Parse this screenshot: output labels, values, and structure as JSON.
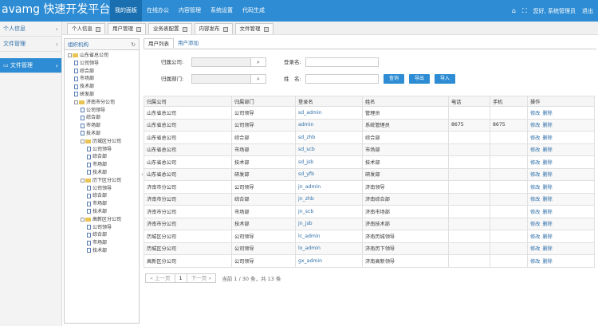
{
  "app": {
    "title": "avamg 快速开发平台"
  },
  "topnav": [
    {
      "label": "我的面板",
      "active": true
    },
    {
      "label": "在线办公",
      "active": false
    },
    {
      "label": "内容管理",
      "active": false
    },
    {
      "label": "系统设置",
      "active": false
    },
    {
      "label": "代码生成",
      "active": false
    }
  ],
  "topright": {
    "user": "您好, 系统管理员",
    "logout": "退出"
  },
  "sidebar": {
    "items": [
      {
        "label": "个人信息",
        "caret": "›"
      },
      {
        "label": "文件管理",
        "caret": "›"
      },
      {
        "label": "文件管理",
        "caret": "‹"
      }
    ]
  },
  "pagetabs": [
    "个人信息",
    "用户管理",
    "业务表配置",
    "内容发布",
    "文件管理"
  ],
  "tree": {
    "header": "组织机构",
    "nodes": [
      {
        "label": "山东省总公司",
        "level": 1,
        "type": "folder",
        "pm": true
      },
      {
        "label": "公司领导",
        "level": 2,
        "type": "page"
      },
      {
        "label": "综合部",
        "level": 2,
        "type": "page"
      },
      {
        "label": "市场部",
        "level": 2,
        "type": "page"
      },
      {
        "label": "技术部",
        "level": 2,
        "type": "page"
      },
      {
        "label": "研发部",
        "level": 2,
        "type": "page"
      },
      {
        "label": "济南市分公司",
        "level": 2,
        "type": "folder",
        "pm": true
      },
      {
        "label": "公司领导",
        "level": 3,
        "type": "page"
      },
      {
        "label": "综合部",
        "level": 3,
        "type": "page"
      },
      {
        "label": "市场部",
        "level": 3,
        "type": "page"
      },
      {
        "label": "技术部",
        "level": 3,
        "type": "page"
      },
      {
        "label": "历城区分公司",
        "level": 3,
        "type": "folder",
        "pm": true
      },
      {
        "label": "公司领导",
        "level": 4,
        "type": "page"
      },
      {
        "label": "综合部",
        "level": 4,
        "type": "page"
      },
      {
        "label": "市场部",
        "level": 4,
        "type": "page"
      },
      {
        "label": "技术部",
        "level": 4,
        "type": "page"
      },
      {
        "label": "历下区分公司",
        "level": 3,
        "type": "folder",
        "pm": true
      },
      {
        "label": "公司领导",
        "level": 4,
        "type": "page"
      },
      {
        "label": "综合部",
        "level": 4,
        "type": "page"
      },
      {
        "label": "市场部",
        "level": 4,
        "type": "page"
      },
      {
        "label": "技术部",
        "level": 4,
        "type": "page"
      },
      {
        "label": "高新区分公司",
        "level": 3,
        "type": "folder",
        "pm": true
      },
      {
        "label": "公司领导",
        "level": 4,
        "type": "page"
      },
      {
        "label": "综合部",
        "level": 4,
        "type": "page"
      },
      {
        "label": "市场部",
        "level": 4,
        "type": "page"
      },
      {
        "label": "技术部",
        "level": 4,
        "type": "page"
      }
    ]
  },
  "subtabs": [
    {
      "label": "用户列表",
      "active": true
    },
    {
      "label": "用户添加",
      "active": false
    }
  ],
  "form": {
    "company_label": "归属公司:",
    "dept_label": "归属部门:",
    "login_label": "登录名:",
    "name_label": "姓　名:",
    "company_value": "",
    "dept_value": "",
    "login_value": "",
    "name_value": "",
    "search_icon": "search-icon",
    "query": "查询",
    "export": "导出",
    "import": "导入"
  },
  "table": {
    "headers": [
      "归属公司",
      "归属部门",
      "登录名",
      "姓名",
      "电话",
      "手机",
      "操作"
    ],
    "rows": [
      [
        "山东省总公司",
        "公司领导",
        "sd_admin",
        "管理员",
        "",
        "",
        "修改",
        "删除"
      ],
      [
        "山东省总公司",
        "公司领导",
        "admin",
        "系统管理员",
        "8675",
        "8675",
        "修改",
        "删除"
      ],
      [
        "山东省总公司",
        "综合部",
        "sd_zhb",
        "综合部",
        "",
        "",
        "修改",
        "删除"
      ],
      [
        "山东省总公司",
        "市场部",
        "sd_scb",
        "市场部",
        "",
        "",
        "修改",
        "删除"
      ],
      [
        "山东省总公司",
        "技术部",
        "sd_jsb",
        "技术部",
        "",
        "",
        "修改",
        "删除"
      ],
      [
        "山东省总公司",
        "研发部",
        "sd_yfb",
        "研发部",
        "",
        "",
        "修改",
        "删除"
      ],
      [
        "济南市分公司",
        "公司领导",
        "jn_admin",
        "济南领导",
        "",
        "",
        "修改",
        "删除"
      ],
      [
        "济南市分公司",
        "综合部",
        "jn_zhb",
        "济南综合部",
        "",
        "",
        "修改",
        "删除"
      ],
      [
        "济南市分公司",
        "市场部",
        "jn_scb",
        "济南市场部",
        "",
        "",
        "修改",
        "删除"
      ],
      [
        "济南市分公司",
        "技术部",
        "jn_jsb",
        "济南技术部",
        "",
        "",
        "修改",
        "删除"
      ],
      [
        "历城区分公司",
        "公司领导",
        "lc_admin",
        "济南历城领导",
        "",
        "",
        "修改",
        "删除"
      ],
      [
        "历城区分公司",
        "公司领导",
        "lx_admin",
        "济南历下领导",
        "",
        "",
        "修改",
        "删除"
      ],
      [
        "高新区分公司",
        "公司领导",
        "gx_admin",
        "济南高新领导",
        "",
        "",
        "修改",
        "删除"
      ]
    ]
  },
  "pager": {
    "prev": "« 上一页",
    "current": "1",
    "next": "下一页 »",
    "info": "当前 1 / 30 条，共 13 条"
  },
  "colors": {
    "topbar": "#2d8cd3",
    "link": "#2d6ea8",
    "button": "#2d8cd3"
  }
}
